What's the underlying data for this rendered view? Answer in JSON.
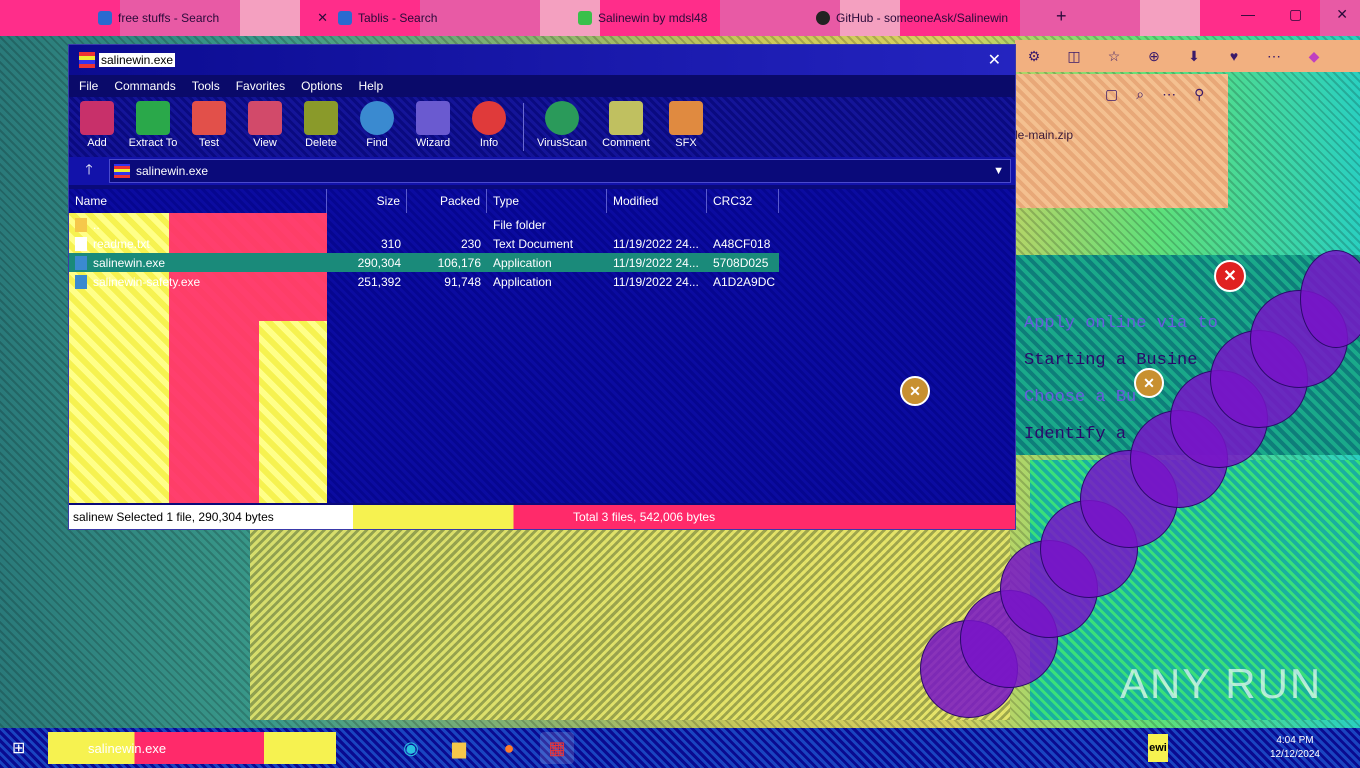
{
  "browser": {
    "tabs": [
      {
        "title": "free stuffs - Search"
      },
      {
        "title": "Tablis - Search"
      },
      {
        "title": "Salinewin by mdsl48"
      },
      {
        "title": "GitHub - someoneAsk/Salinewin"
      }
    ],
    "new_tab": "+",
    "window_controls": [
      "—",
      "▢",
      "✕"
    ],
    "downloads": {
      "file_name": "le-main.zip"
    },
    "page_lines": [
      "Apply online via to",
      "Starting a Busine",
      "Choose a Bu",
      "Identify a"
    ]
  },
  "winrar": {
    "title": "salinewin.exe",
    "close": "✕",
    "menu": [
      "File",
      "Commands",
      "Tools",
      "Favorites",
      "Options",
      "Help"
    ],
    "toolbar": [
      {
        "label": "Add",
        "color": "#c8306a"
      },
      {
        "label": "Extract To",
        "color": "#2aa84a"
      },
      {
        "label": "Test",
        "color": "#e2504a"
      },
      {
        "label": "View",
        "color": "#d24a6a"
      },
      {
        "label": "Delete",
        "color": "#8a9a2a"
      },
      {
        "label": "Find",
        "color": "#3a8ad0"
      },
      {
        "label": "Wizard",
        "color": "#6a5ad0"
      },
      {
        "label": "Info",
        "color": "#e03a3a"
      },
      {
        "label": "VirusScan",
        "color": "#2a9a5a"
      },
      {
        "label": "Comment",
        "color": "#c0c060"
      },
      {
        "label": "SFX",
        "color": "#e08a40"
      }
    ],
    "up_arrow": "🡑",
    "path": "salinewin.exe",
    "columns": [
      "Name",
      "Size",
      "Packed",
      "Type",
      "Modified",
      "CRC32"
    ],
    "rows": [
      {
        "name": "..",
        "size": "",
        "packed": "",
        "type": "File folder",
        "modified": "",
        "crc": "",
        "icon": "#f6c84a"
      },
      {
        "name": "readme.txt",
        "size": "310",
        "packed": "230",
        "type": "Text Document",
        "modified": "11/19/2022 24...",
        "crc": "A48CF018",
        "icon": "#ffffff"
      },
      {
        "name": "salinewin.exe",
        "size": "290,304",
        "packed": "106,176",
        "type": "Application",
        "modified": "11/19/2022 24...",
        "crc": "5708D025",
        "icon": "#3a8ad0"
      },
      {
        "name": "salinewin-safety.exe",
        "size": "251,392",
        "packed": "91,748",
        "type": "Application",
        "modified": "11/19/2022 24...",
        "crc": "A1D2A9DC",
        "icon": "#3a8ad0"
      }
    ],
    "status_left": "salinew  Selected 1 file, 290,304 bytes",
    "status_right": "Total 3 files, 542,006 bytes"
  },
  "taskbar": {
    "search_text": "salinewin.exe",
    "apps": [
      "edge",
      "explorer",
      "firefox",
      "winrar"
    ],
    "tray_label": "ewi",
    "clock_time": "4:04 PM",
    "clock_date": "12/12/2024"
  },
  "watermark": "ANY RUN"
}
